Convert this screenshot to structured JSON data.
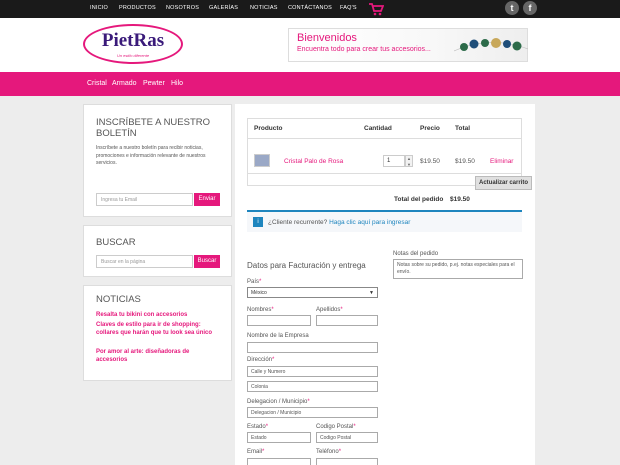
{
  "topnav": {
    "items": [
      "INICIO",
      "PRODUCTOS",
      "NOSOTROS",
      "GALERÍAS",
      "NOTICIAS",
      "CONTÁCTANOS",
      "FAQ'S"
    ],
    "cart_icon": "cart-icon",
    "social": [
      "twitter-icon",
      "facebook-icon"
    ]
  },
  "header": {
    "logo_text": "PietRas",
    "logo_sub": "Un estilo diferente",
    "banner_title": "Bienvenidos",
    "banner_subtitle": "Encuentra todo para crear tus accesorios..."
  },
  "categories": [
    "Cristal",
    "Armado",
    "Pewter",
    "Hilo"
  ],
  "sidebar": {
    "newsletter": {
      "title": "INSCRÍBETE A NUESTRO BOLETÍN",
      "text": "Inscríbete a nuestro boletín para recibir noticias, promociones e información relevante de nuestros servicios.",
      "placeholder": "Ingresa tu Email",
      "button": "Enviar"
    },
    "search": {
      "title": "BUSCAR",
      "placeholder": "Buscar en la página",
      "button": "Buscar"
    },
    "news": {
      "title": "NOTICIAS",
      "items": [
        "Resalta tu bikini con accesorios",
        "Claves de estilo para ir de shopping: collares que harán que tu look sea único",
        "Por amor al arte: diseñadoras de accesorios"
      ]
    }
  },
  "cart": {
    "headers": {
      "product": "Producto",
      "quantity": "Cantidad",
      "price": "Precio",
      "total": "Total"
    },
    "item": {
      "name": "Cristal Palo de Rosa",
      "quantity": "1",
      "price": "$19.50",
      "total": "$19.50",
      "remove": "Eliminar"
    },
    "update_button": "Actualizar carrito",
    "order_total_label": "Total del pedido",
    "order_total": "$19.50"
  },
  "returning": {
    "text": "¿Cliente recurrente?",
    "link": "Haga clic aquí para ingresar"
  },
  "billing": {
    "title": "Datos para Facturación y entrega",
    "country_label": "País",
    "country_value": "México",
    "first_name_label": "Nombres",
    "last_name_label": "Apellidos",
    "company_label": "Nombre de la Empresa",
    "address_label": "Dirección",
    "address_placeholder": "Calle y Numero",
    "address2_placeholder": "Colonia",
    "municipality_label": "Delegacion / Municipio",
    "municipality_placeholder": "Delegacion / Municipio",
    "state_label": "Estado",
    "state_placeholder": "Estado",
    "zip_label": "Codigo Postal",
    "zip_placeholder": "Codigo Postal",
    "email_label": "Email",
    "phone_label": "Teléfono",
    "notes_label": "Notas del pedido",
    "notes_placeholder": "Notas sobre su pedido, p.ej. notas especiales para el envío."
  },
  "colors": {
    "brand_pink": "#e5187c",
    "dark_nav": "#1a1a1a",
    "info_blue": "#1e85be"
  }
}
